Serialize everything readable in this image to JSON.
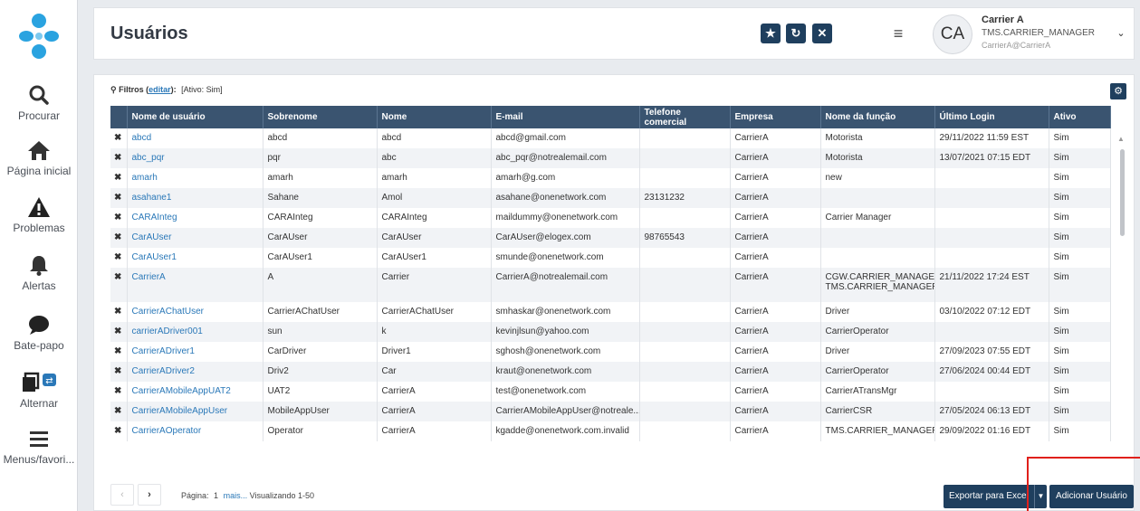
{
  "sidebar": {
    "items": [
      {
        "label": "Procurar",
        "icon": "search-icon"
      },
      {
        "label": "Página inicial",
        "icon": "home-icon"
      },
      {
        "label": "Problemas",
        "icon": "warning-icon"
      },
      {
        "label": "Alertas",
        "icon": "bell-icon"
      },
      {
        "label": "Bate-papo",
        "icon": "chat-icon"
      },
      {
        "label": "Alternar",
        "icon": "switch-icon"
      },
      {
        "label": "Menus/favori...",
        "icon": "menu-icon"
      }
    ]
  },
  "header": {
    "title": "Usuários",
    "user": {
      "initials": "CA",
      "name": "Carrier A",
      "role": "TMS.CARRIER_MANAGER",
      "email": "CarrierA@CarrierA"
    }
  },
  "filters": {
    "prefix": "Filtros (",
    "link": "editar",
    "suffix": "):",
    "value": "[Ativo: Sim]"
  },
  "table": {
    "columns": [
      "Nome de usuário",
      "Sobrenome",
      "Nome",
      "E-mail",
      "Telefone comercial",
      "Empresa",
      "Nome da função",
      "Último Login",
      "Ativo"
    ],
    "rows": [
      [
        "abcd",
        "abcd",
        "abcd",
        "abcd@gmail.com",
        "",
        "CarrierA",
        "Motorista",
        "29/11/2022 11:59 EST",
        "Sim"
      ],
      [
        "abc_pqr",
        "pqr",
        "abc",
        "abc_pqr@notrealemail.com",
        "",
        "CarrierA",
        "Motorista",
        "13/07/2021 07:15 EDT",
        "Sim"
      ],
      [
        "amarh",
        "amarh",
        "amarh",
        "amarh@g.com",
        "",
        "CarrierA",
        "new",
        "",
        "Sim"
      ],
      [
        "asahane1",
        "Sahane",
        "Amol",
        "asahane@onenetwork.com",
        "23131232",
        "CarrierA",
        "",
        "",
        "Sim"
      ],
      [
        "CARAInteg",
        "CARAInteg",
        "CARAInteg",
        "maildummy@onenetwork.com",
        "",
        "CarrierA",
        "Carrier Manager",
        "",
        "Sim"
      ],
      [
        "CarAUser",
        "CarAUser",
        "CarAUser",
        "CarAUser@elogex.com",
        "98765543",
        "CarrierA",
        "",
        "",
        "Sim"
      ],
      [
        "CarAUser1",
        "CarAUser1",
        "CarAUser1",
        "smunde@onenetwork.com",
        "",
        "CarrierA",
        "",
        "",
        "Sim"
      ],
      [
        "CarrierA",
        "A",
        "Carrier",
        "CarrierA@notrealemail.com",
        "",
        "CarrierA",
        "CGW.CARRIER_MANAGER, TMS.CARRIER_MANAGER",
        "21/11/2022 17:24 EST",
        "Sim"
      ],
      [
        "CarrierAChatUser",
        "CarrierAChatUser",
        "CarrierAChatUser",
        "smhaskar@onenetwork.com",
        "",
        "CarrierA",
        "Driver",
        "03/10/2022 07:12 EDT",
        "Sim"
      ],
      [
        "carrierADriver001",
        "sun",
        "k",
        "kevinjlsun@yahoo.com",
        "",
        "CarrierA",
        "CarrierOperator",
        "",
        "Sim"
      ],
      [
        "CarrierADriver1",
        "CarDriver",
        "Driver1",
        "sghosh@onenetwork.com",
        "",
        "CarrierA",
        "Driver",
        "27/09/2023 07:55 EDT",
        "Sim"
      ],
      [
        "CarrierADriver2",
        "Driv2",
        "Car",
        "kraut@onenetwork.com",
        "",
        "CarrierA",
        "CarrierOperator",
        "27/06/2024 00:44 EDT",
        "Sim"
      ],
      [
        "CarrierAMobileAppUAT2",
        "UAT2",
        "CarrierA",
        "test@onenetwork.com",
        "",
        "CarrierA",
        "CarrierATransMgr",
        "",
        "Sim"
      ],
      [
        "CarrierAMobileAppUser",
        "MobileAppUser",
        "CarrierA",
        "CarrierAMobileAppUser@notreale...",
        "",
        "CarrierA",
        "CarrierCSR",
        "27/05/2024 06:13 EDT",
        "Sim"
      ],
      [
        "CarrierAOperator",
        "Operator",
        "CarrierA",
        "kgadde@onenetwork.com.invalid",
        "",
        "CarrierA",
        "TMS.CARRIER_MANAGER",
        "29/09/2022 01:16 EDT",
        "Sim"
      ]
    ]
  },
  "pagination": {
    "label": "Página:",
    "page": "1",
    "more": "mais...",
    "viewing": "Visualizando 1-50"
  },
  "actions": {
    "export": "Exportar para Excel",
    "add": "Adicionar Usuário"
  }
}
